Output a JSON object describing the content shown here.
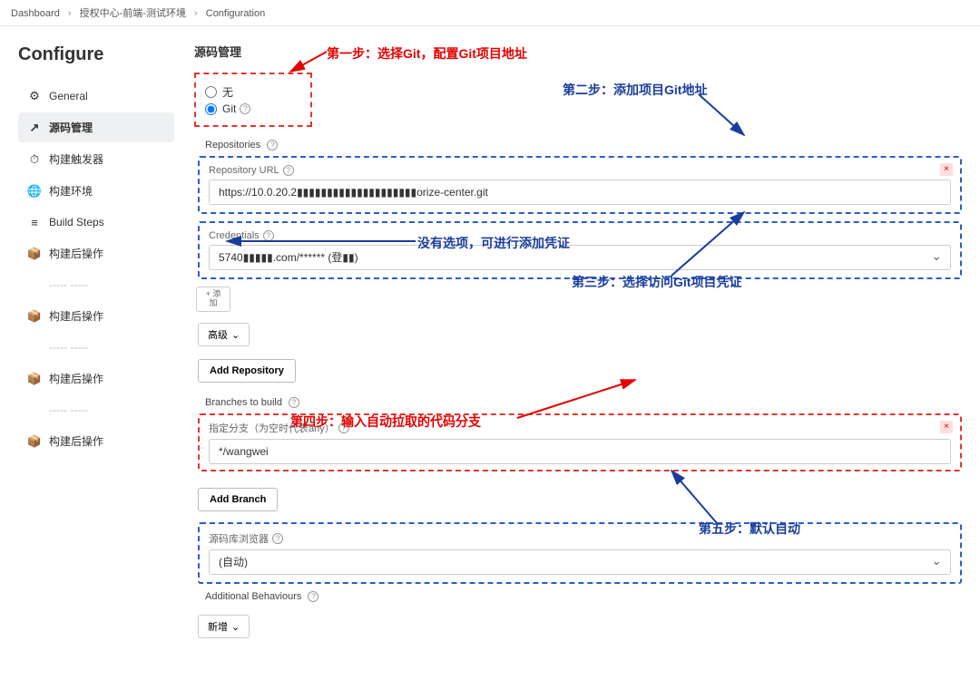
{
  "breadcrumb": {
    "items": [
      "Dashboard",
      "授权中心-前端-测试环境",
      "Configuration"
    ]
  },
  "sidebar": {
    "title": "Configure",
    "items": [
      {
        "icon": "⚙",
        "label": "General"
      },
      {
        "icon": "↗",
        "label": "源码管理"
      },
      {
        "icon": "⏱",
        "label": "构建触发器"
      },
      {
        "icon": "🌐",
        "label": "构建环境"
      },
      {
        "icon": "≡",
        "label": "Build Steps"
      },
      {
        "icon": "📦",
        "label": "构建后操作"
      },
      {
        "icon": "-",
        "label": "----- -----"
      },
      {
        "icon": "📦",
        "label": "构建后操作"
      },
      {
        "icon": "-",
        "label": "----- -----"
      },
      {
        "icon": "📦",
        "label": "构建后操作"
      },
      {
        "icon": "-",
        "label": "----- -----"
      },
      {
        "icon": "📦",
        "label": "构建后操作"
      }
    ]
  },
  "content": {
    "section_title": "源码管理",
    "radio": {
      "none": "无",
      "git": "Git"
    },
    "repos_label": "Repositories",
    "repo_url_label": "Repository URL",
    "repo_url_value": "https://10.0.20.2▮▮▮▮▮▮▮▮▮▮▮▮▮▮▮▮▮▮▮▮orize-center.git",
    "credentials_label": "Credentials",
    "credentials_value": "5740▮▮▮▮▮.com/****** (登▮▮)",
    "add_cred_btn": "+ 添\n加",
    "advanced_btn": "高级",
    "add_repo_btn": "Add Repository",
    "branches_label": "Branches to build",
    "branch_spec_label": "指定分支（为空时代表any）",
    "branch_value": "*/wangwei",
    "add_branch_btn": "Add Branch",
    "browser_label": "源码库浏览器",
    "browser_value": "(自动)",
    "addl_label": "Additional Behaviours",
    "addl_btn": "新增"
  },
  "annotations": {
    "step1": "第一步：选择Git，配置Git项目地址",
    "step2": "第二步：添加项目Git地址",
    "nocred": "没有选项，可进行添加凭证",
    "step3": "第三步：选择访问Git项目凭证",
    "step4": "第四步：输入自动拉取的代码分支",
    "step5": "第五步：默认自动"
  }
}
